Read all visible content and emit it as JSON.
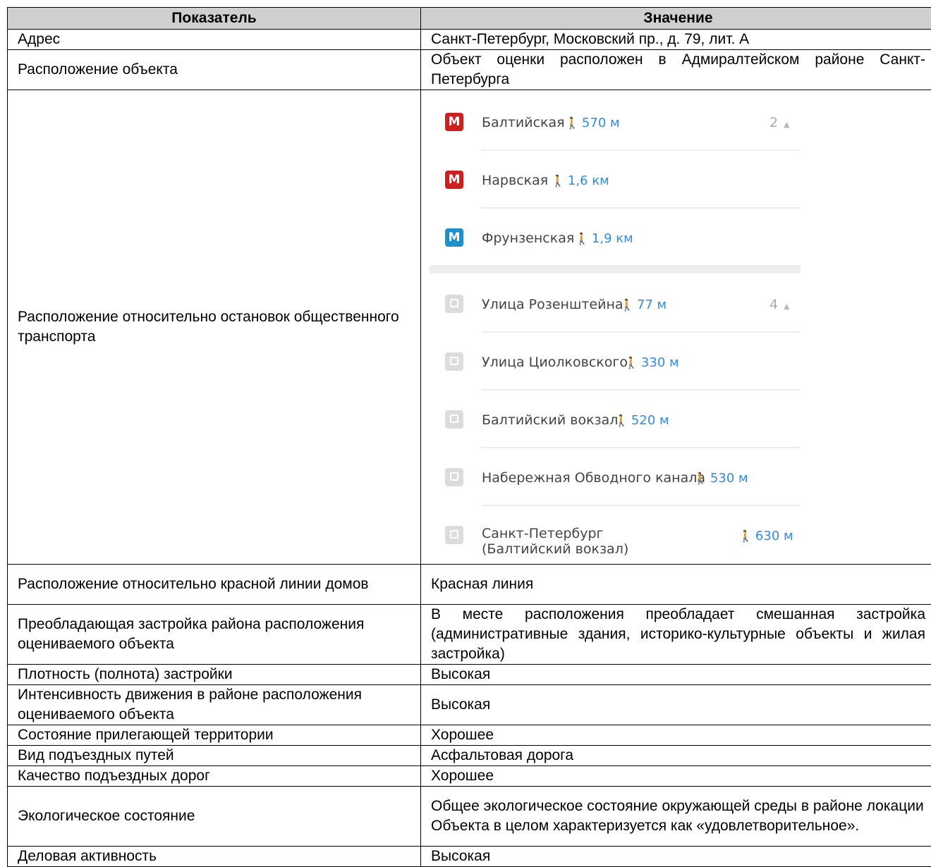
{
  "header": {
    "col1": "Показатель",
    "col2": "Значение"
  },
  "rows": [
    {
      "label": "Адрес",
      "value": "Санкт-Петербург, Московский пр., д. 79, лит. А"
    },
    {
      "label": "Расположение объекта",
      "value": "Объект оценки расположен в Адмиралтейском районе Санкт-Петербурга"
    },
    {
      "label": "Расположение относительно остановок общественного транспорта"
    },
    {
      "label": "Расположение относительно красной линии домов",
      "value": "Красная линия"
    },
    {
      "label": "Преобладающая застройка района расположения оцениваемого объекта",
      "value": "В месте расположения преобладает смешанная застройка (административные здания, историко-культурные объекты и жилая застройка)"
    },
    {
      "label": "Плотность (полнота) застройки",
      "value": "Высокая"
    },
    {
      "label": "Интенсивность движения в районе расположения оцениваемого объекта",
      "value": "Высокая"
    },
    {
      "label": "Состояние прилегающей территории",
      "value": "Хорошее"
    },
    {
      "label": "Вид подъездных путей",
      "value": "Асфальтовая дорога"
    },
    {
      "label": "Качество подъездных дорог",
      "value": "Хорошее"
    },
    {
      "label": "Экологическое состояние",
      "value": "Общее экологическое состояние окружающей среды в районе локации Объекта в целом характеризуется как «удовлетворительное»."
    },
    {
      "label": "Деловая активность",
      "value": "Высокая"
    }
  ],
  "transport": {
    "metro": [
      {
        "letter": "М",
        "color": "#cc1f1f",
        "name": "Балтийская",
        "dist": "570 м",
        "count": "2"
      },
      {
        "letter": "М",
        "color": "#cc1f1f",
        "name": "Нарвская",
        "dist": "1,6 км"
      },
      {
        "letter": "М",
        "color": "#1f8fc8",
        "name": "Фрунзенская",
        "dist": "1,9 км"
      }
    ],
    "stops": [
      {
        "name": "Улица Розенштейна",
        "dist": "77 м",
        "count": "4"
      },
      {
        "name": "Улица Циолковского",
        "dist": "330 м"
      },
      {
        "name": "Балтийский вокзал",
        "dist": "520 м"
      },
      {
        "name": "Набережная Обводного канала",
        "dist": "530 м"
      },
      {
        "name": "Санкт-Петербург (Балтийский вокзал)",
        "dist": "630 м"
      }
    ],
    "walk_icon": "walking-person-icon",
    "stop_icon": "bus-stop-icon",
    "metro_icon": "metro-icon"
  }
}
